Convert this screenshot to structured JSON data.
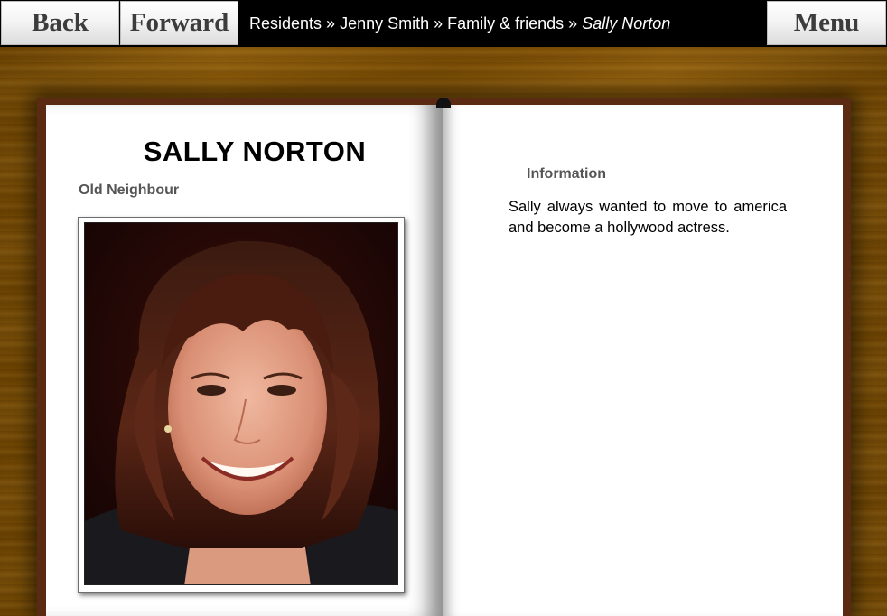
{
  "toolbar": {
    "back_label": "Back",
    "forward_label": "Forward",
    "menu_label": "Menu"
  },
  "breadcrumb": {
    "items": [
      "Residents",
      "Jenny Smith",
      "Family & friends"
    ],
    "separator": "»",
    "current": "Sally Norton"
  },
  "profile": {
    "name": "SALLY NORTON",
    "relation": "Old Neighbour",
    "photo": "portrait-photo",
    "info_heading": "Information",
    "info_text": "Sally always wanted to move to america and become a hollywood actress."
  },
  "colors": {
    "topbar": "#000000",
    "wood": "#8a5a08",
    "book_cover": "#5b2a12",
    "page": "#ffffff",
    "label_gray": "#555555"
  }
}
